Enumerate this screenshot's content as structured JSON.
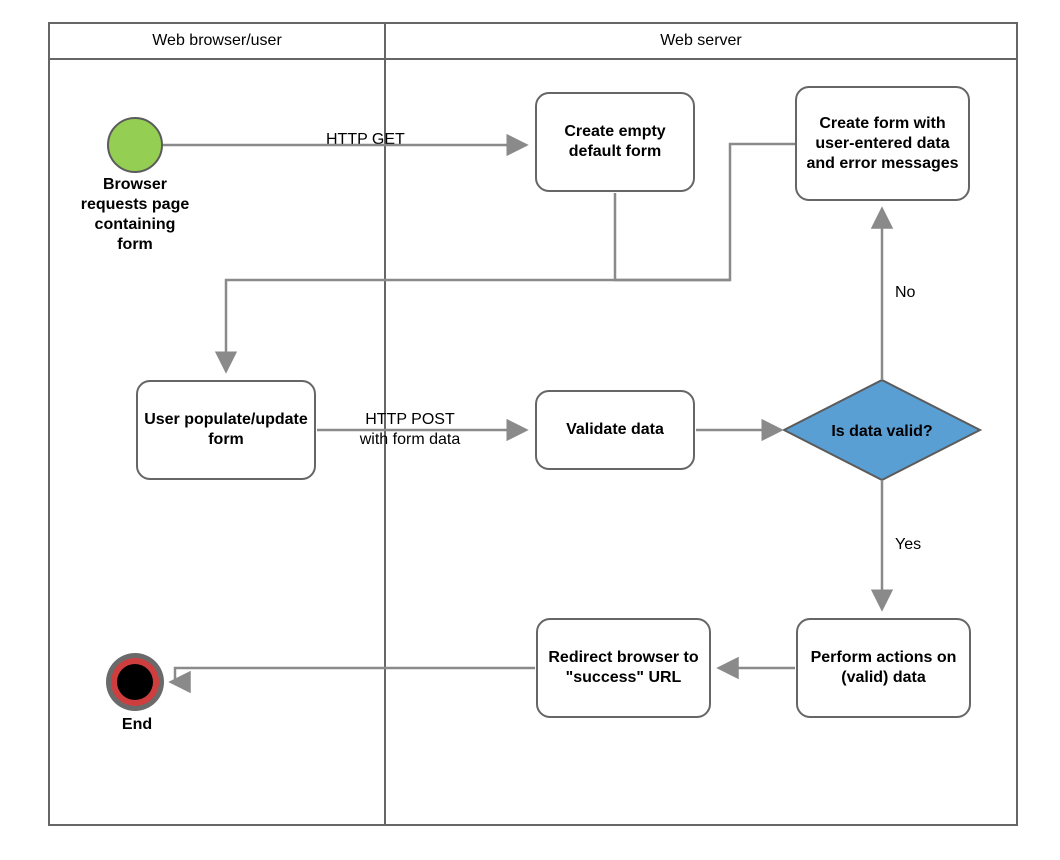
{
  "swimlanes": {
    "left_header": "Web browser/user",
    "right_header": "Web server"
  },
  "nodes": {
    "start_label": "Browser requests page containing form",
    "create_empty": "Create empty default form",
    "create_error": "Create form with user-entered data and error messages",
    "user_populate": "User populate/update form",
    "validate": "Validate data",
    "decision": "Is data valid?",
    "perform": "Perform actions on (valid) data",
    "redirect": "Redirect browser to \"success\" URL",
    "end_label": "End"
  },
  "edges": {
    "http_get": "HTTP GET",
    "http_post_1": "HTTP POST",
    "http_post_2": "with form data",
    "no": "No",
    "yes": "Yes"
  }
}
